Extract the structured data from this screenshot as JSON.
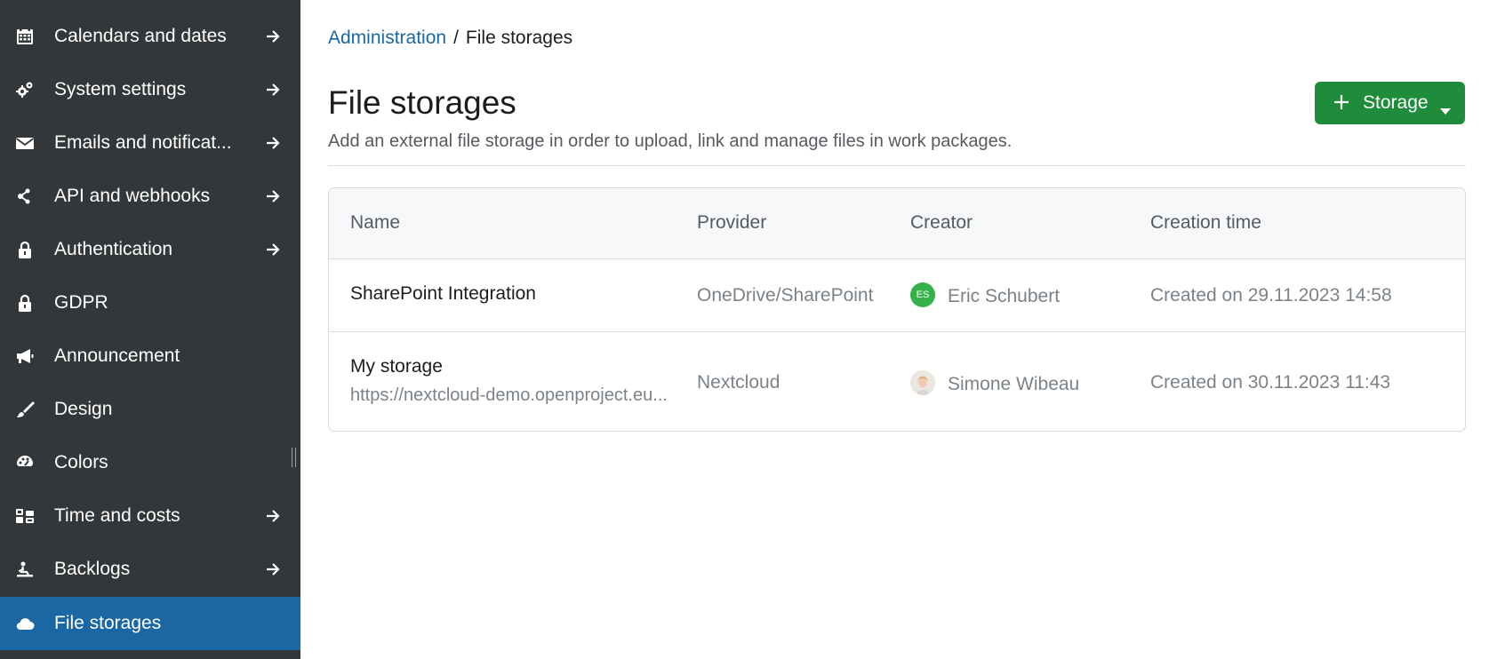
{
  "sidebar": {
    "items": [
      {
        "label": "Calendars and dates",
        "icon": "calendar-icon",
        "has_arrow": true
      },
      {
        "label": "System settings",
        "icon": "gears-icon",
        "has_arrow": true
      },
      {
        "label": "Emails and notificat...",
        "icon": "envelope-icon",
        "has_arrow": true
      },
      {
        "label": "API and webhooks",
        "icon": "network-icon",
        "has_arrow": true
      },
      {
        "label": "Authentication",
        "icon": "lock-icon",
        "has_arrow": true
      },
      {
        "label": "GDPR",
        "icon": "lock-icon",
        "has_arrow": false
      },
      {
        "label": "Announcement",
        "icon": "megaphone-icon",
        "has_arrow": false
      },
      {
        "label": "Design",
        "icon": "brush-icon",
        "has_arrow": false
      },
      {
        "label": "Colors",
        "icon": "palette-icon",
        "has_arrow": false
      },
      {
        "label": "Time and costs",
        "icon": "time-costs-icon",
        "has_arrow": true
      },
      {
        "label": "Backlogs",
        "icon": "backlogs-icon",
        "has_arrow": true
      },
      {
        "label": "File storages",
        "icon": "cloud-icon",
        "has_arrow": false,
        "active": true
      }
    ],
    "active_color": "#1a67a3",
    "background_color": "#333739"
  },
  "breadcrumb": {
    "parent": "Administration",
    "separator": "/",
    "current": "File storages"
  },
  "page": {
    "title": "File storages",
    "description": "Add an external file storage in order to upload, link and manage files in work packages."
  },
  "toolbar": {
    "add_button_label": "Storage",
    "add_button_icon": "plus-icon",
    "add_button_color": "#1e8c3a"
  },
  "table": {
    "headers": {
      "name": "Name",
      "provider": "Provider",
      "creator": "Creator",
      "created": "Creation time"
    },
    "rows": [
      {
        "name": "SharePoint Integration",
        "host": "",
        "provider": "OneDrive/SharePoint",
        "creator": "Eric Schubert",
        "creator_initials": "ES",
        "created": "Created on 29.11.2023 14:58"
      },
      {
        "name": "My storage",
        "host": "https://nextcloud-demo.openproject.eu...",
        "provider": "Nextcloud",
        "creator": "Simone Wibeau",
        "creator_initials": "",
        "created": "Created on 30.11.2023 11:43"
      }
    ]
  }
}
